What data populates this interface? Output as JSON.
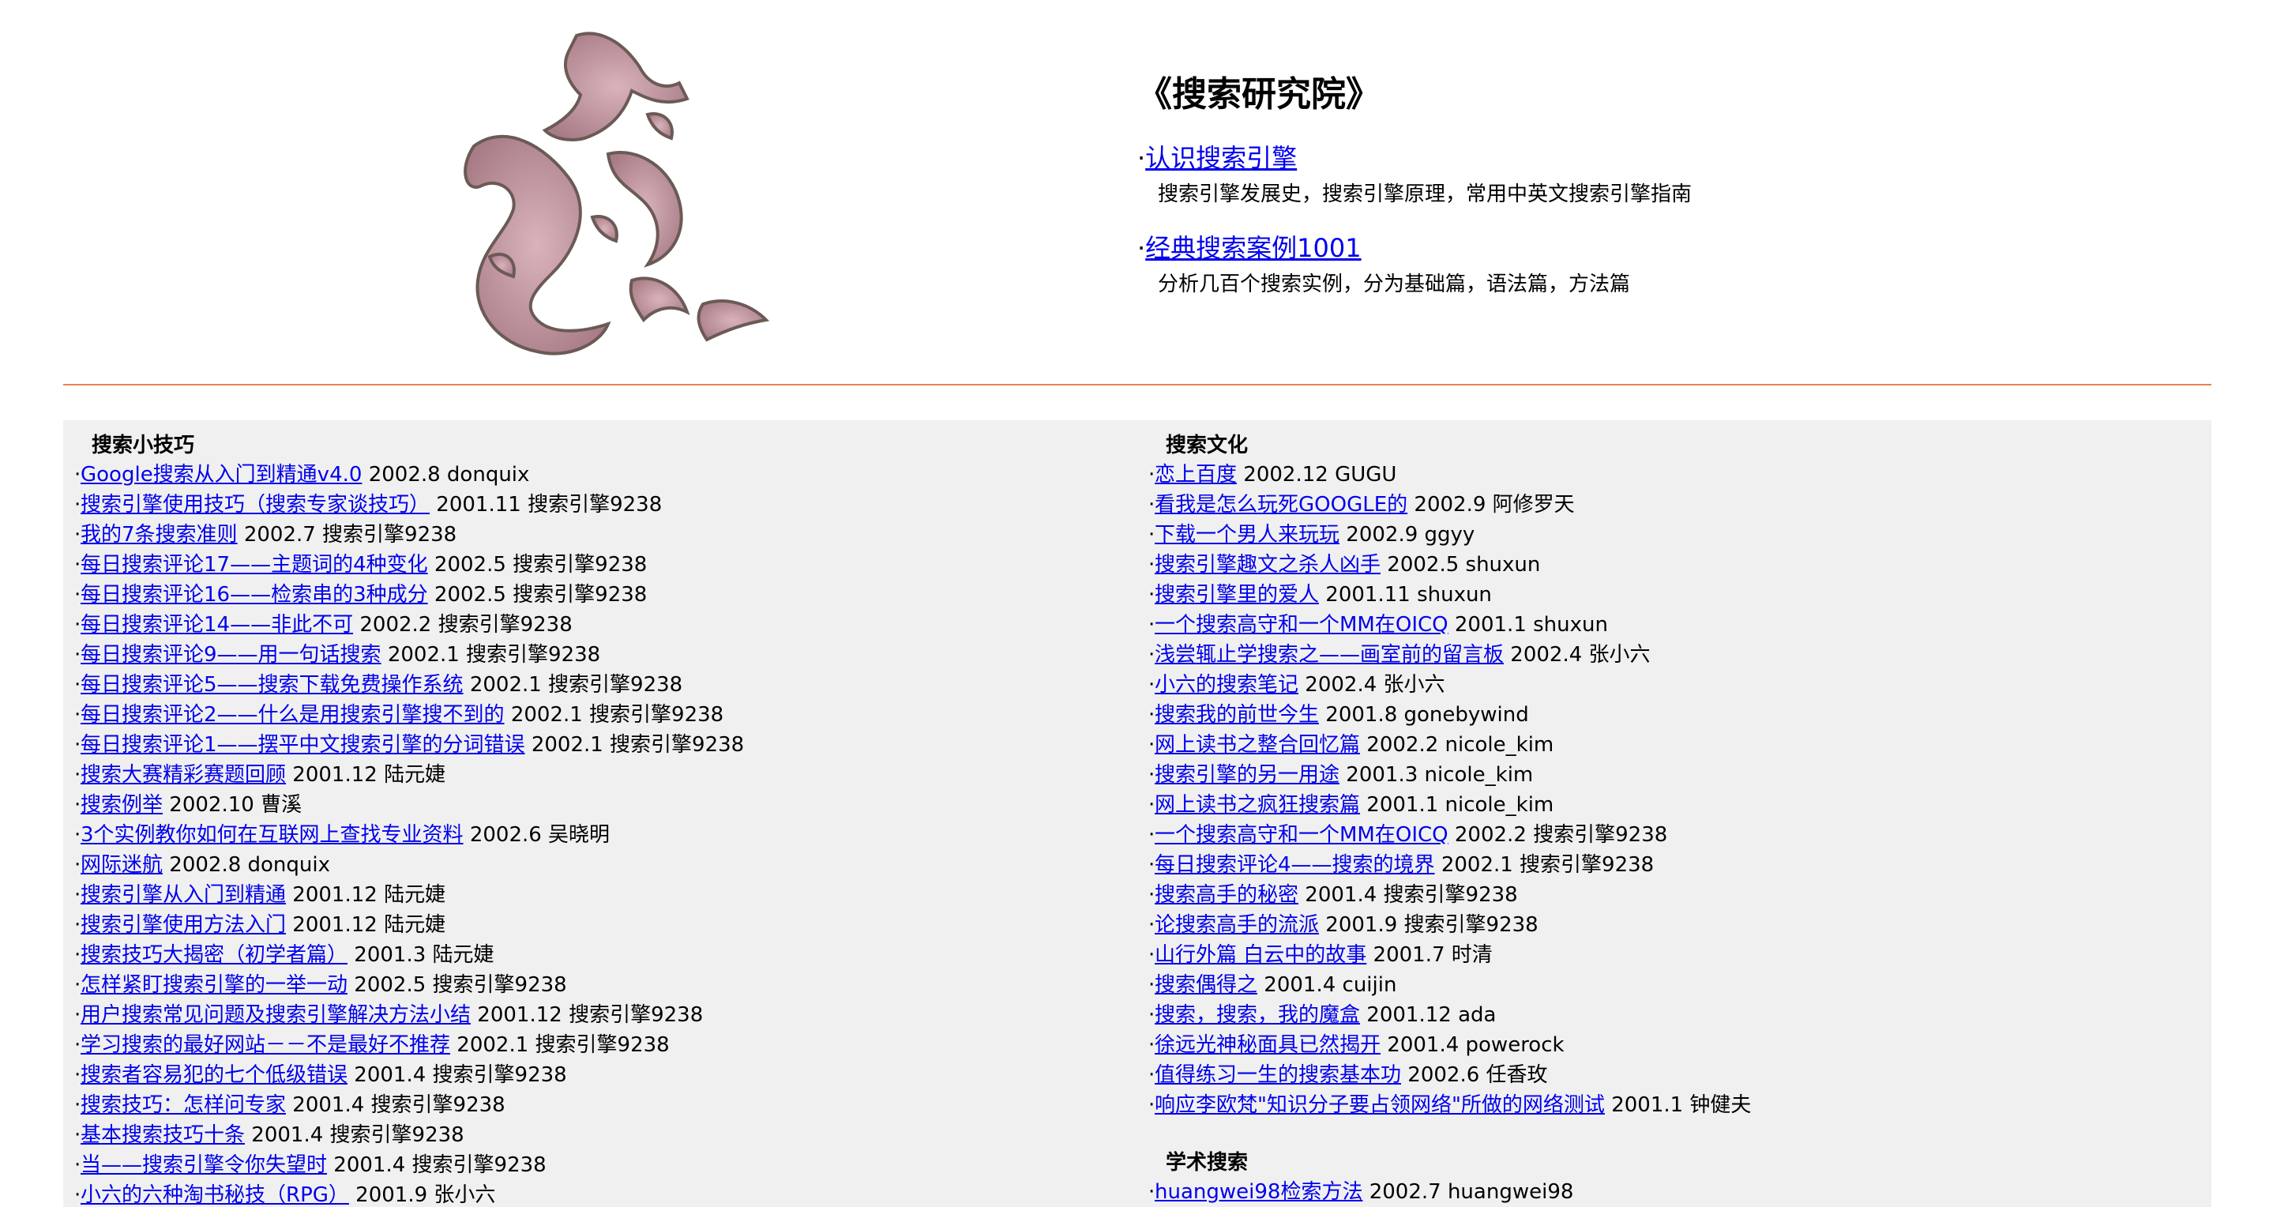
{
  "header": {
    "title": "《搜索研究院》",
    "intro": [
      {
        "link": "认识搜索引擎",
        "desc": "搜索引擎发展史，搜索引擎原理，常用中英文搜索引擎指南"
      },
      {
        "link": "经典搜索案例1001",
        "desc": "分析几百个搜索实例，分为基础篇，语法篇，方法篇"
      }
    ]
  },
  "colors": {
    "divider": "#e8834e",
    "link": "#0000ee",
    "panel_bg": "#f0f0f0"
  },
  "sections": {
    "tips": {
      "title": "搜索小技巧",
      "items": [
        {
          "link": "Google搜索从入门到精通v4.0",
          "meta": "2002.8 donquix"
        },
        {
          "link": "搜索引擎使用技巧（搜索专家谈技巧）",
          "meta": "2001.11 搜索引擎9238"
        },
        {
          "link": "我的7条搜索准则",
          "meta": "2002.7 搜索引擎9238"
        },
        {
          "link": "每日搜索评论17——主题词的4种变化",
          "meta": "2002.5 搜索引擎9238"
        },
        {
          "link": "每日搜索评论16——检索串的3种成分",
          "meta": "2002.5 搜索引擎9238"
        },
        {
          "link": "每日搜索评论14——非此不可",
          "meta": "2002.2 搜索引擎9238"
        },
        {
          "link": "每日搜索评论9——用一句话搜索",
          "meta": "2002.1 搜索引擎9238"
        },
        {
          "link": "每日搜索评论5——搜索下载免费操作系统",
          "meta": "2002.1 搜索引擎9238"
        },
        {
          "link": "每日搜索评论2——什么是用搜索引擎搜不到的",
          "meta": "2002.1 搜索引擎9238"
        },
        {
          "link": "每日搜索评论1——摆平中文搜索引擎的分词错误",
          "meta": "2002.1 搜索引擎9238"
        },
        {
          "link": "搜索大赛精彩赛题回顾",
          "meta": "2001.12 陆元婕"
        },
        {
          "link": "搜索例举",
          "meta": "2002.10 曹溪"
        },
        {
          "link": "3个实例教你如何在互联网上查找专业资料",
          "meta": "2002.6 吴晓明"
        },
        {
          "link": "网际迷航",
          "meta": "2002.8 donquix"
        },
        {
          "link": "搜索引擎从入门到精通",
          "meta": "2001.12 陆元婕"
        },
        {
          "link": "搜索引擎使用方法入门",
          "meta": "2001.12 陆元婕"
        },
        {
          "link": "搜索技巧大揭密（初学者篇）",
          "meta": "2001.3 陆元婕"
        },
        {
          "link": "怎样紧盯搜索引擎的一举一动",
          "meta": "2002.5 搜索引擎9238"
        },
        {
          "link": "用户搜索常见问题及搜索引擎解决方法小结",
          "meta": "2001.12 搜索引擎9238"
        },
        {
          "link": "学习搜索的最好网站－－不是最好不推荐",
          "meta": "2002.1 搜索引擎9238"
        },
        {
          "link": "搜索者容易犯的七个低级错误",
          "meta": "2001.4 搜索引擎9238"
        },
        {
          "link": "搜索技巧：怎样问专家",
          "meta": "2001.4 搜索引擎9238"
        },
        {
          "link": "基本搜索技巧十条",
          "meta": "2001.4 搜索引擎9238"
        },
        {
          "link": "当——搜索引擎令你失望时",
          "meta": "2001.4 搜索引擎9238"
        },
        {
          "link": "小六的六种淘书秘技（RPG）",
          "meta": "2001.9 张小六"
        }
      ]
    },
    "culture": {
      "title": "搜索文化",
      "items": [
        {
          "link": "恋上百度",
          "meta": "2002.12 GUGU"
        },
        {
          "link": "看我是怎么玩死GOOGLE的",
          "meta": "2002.9 阿修罗天"
        },
        {
          "link": "下载一个男人来玩玩",
          "meta": "2002.9 ggyy"
        },
        {
          "link": "搜索引擎趣文之杀人凶手",
          "meta": "2002.5 shuxun"
        },
        {
          "link": "搜索引擎里的爱人",
          "meta": "2001.11 shuxun"
        },
        {
          "link": "一个搜索高守和一个MM在OICQ",
          "meta": "2001.1 shuxun"
        },
        {
          "link": "浅尝辄止学搜索之——画室前的留言板",
          "meta": "2002.4 张小六"
        },
        {
          "link": "小六的搜索笔记",
          "meta": "2002.4 张小六"
        },
        {
          "link": "搜索我的前世今生",
          "meta": "2001.8 gonebywind"
        },
        {
          "link": "网上读书之整合回忆篇",
          "meta": "2002.2 nicole_kim"
        },
        {
          "link": "搜索引擎的另一用途",
          "meta": "2001.3 nicole_kim"
        },
        {
          "link": "网上读书之疯狂搜索篇",
          "meta": "2001.1 nicole_kim"
        },
        {
          "link": "一个搜索高守和一个MM在OICQ",
          "meta": "2002.2 搜索引擎9238"
        },
        {
          "link": "每日搜索评论4——搜索的境界",
          "meta": "2002.1 搜索引擎9238"
        },
        {
          "link": "搜索高手的秘密",
          "meta": "2001.4 搜索引擎9238"
        },
        {
          "link": "论搜索高手的流派",
          "meta": "2001.9 搜索引擎9238"
        },
        {
          "link": "山行外篇 白云中的故事",
          "meta": "2001.7 时清"
        },
        {
          "link": "搜索偶得之",
          "meta": "2001.4 cuijin"
        },
        {
          "link": "搜索，搜索，我的魔盒",
          "meta": "2001.12 ada"
        },
        {
          "link": "徐远光神秘面具已然揭开",
          "meta": "2001.4 powerock"
        },
        {
          "link": "值得练习一生的搜索基本功",
          "meta": "2002.6 任香玫"
        },
        {
          "link": "响应李欧梵\"知识分子要占领网络\"所做的网络测试",
          "meta": "2001.1 钟健夫"
        }
      ]
    },
    "academic": {
      "title": "学术搜索",
      "items": [
        {
          "link": "huangwei98检索方法",
          "meta": "2002.7 huangwei98"
        }
      ]
    }
  }
}
